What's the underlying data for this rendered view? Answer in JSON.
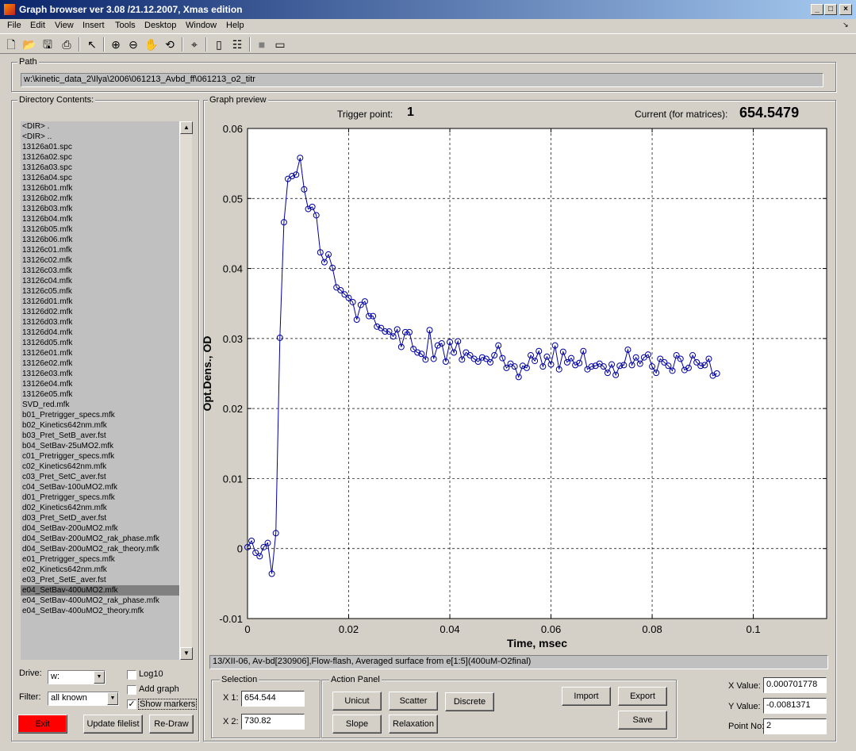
{
  "window": {
    "title": "Graph browser ver 3.08 /21.12.2007, Xmas edition"
  },
  "menu": [
    "File",
    "Edit",
    "View",
    "Insert",
    "Tools",
    "Desktop",
    "Window",
    "Help"
  ],
  "path": {
    "label": "Path",
    "value": "w:\\kinetic_data_2\\Ilya\\2006\\061213_Avbd_ff\\061213_o2_titr"
  },
  "directory": {
    "label": "Directory Contents:",
    "items": [
      "<DIR>      .",
      "<DIR>      ..",
      "13126a01.spc",
      "13126a02.spc",
      "13126a03.spc",
      "13126a04.spc",
      "13126b01.mfk",
      "13126b02.mfk",
      "13126b03.mfk",
      "13126b04.mfk",
      "13126b05.mfk",
      "13126b06.mfk",
      "13126c01.mfk",
      "13126c02.mfk",
      "13126c03.mfk",
      "13126c04.mfk",
      "13126c05.mfk",
      "13126d01.mfk",
      "13126d02.mfk",
      "13126d03.mfk",
      "13126d04.mfk",
      "13126d05.mfk",
      "13126e01.mfk",
      "13126e02.mfk",
      "13126e03.mfk",
      "13126e04.mfk",
      "13126e05.mfk",
      "SVD_red.mfk",
      "b01_Pretrigger_specs.mfk",
      "b02_Kinetics642nm.mfk",
      "b03_Pret_SetB_aver.fst",
      "b04_SetBav-25uMO2.mfk",
      "c01_Pretrigger_specs.mfk",
      "c02_Kinetics642nm.mfk",
      "c03_Pret_SetC_aver.fst",
      "c04_SetBav-100uMO2.mfk",
      "d01_Pretrigger_specs.mfk",
      "d02_Kinetics642nm.mfk",
      "d03_Pret_SetD_aver.fst",
      "d04_SetBav-200uMO2.mfk",
      "d04_SetBav-200uMO2_rak_phase.mfk",
      "d04_SetBav-200uMO2_rak_theory.mfk",
      "e01_Pretrigger_specs.mfk",
      "e02_Kinetics642nm.mfk",
      "e03_Pret_SetE_aver.fst",
      "e04_SetBav-400uMO2.mfk",
      "e04_SetBav-400uMO2_rak_phase.mfk",
      "e04_SetBav-400uMO2_theory.mfk"
    ],
    "selected_index": 45
  },
  "controls": {
    "drive_label": "Drive:",
    "drive_value": "w:",
    "filter_label": "Filter:",
    "filter_value": "all known",
    "log10_label": "Log10",
    "log10_checked": false,
    "addgraph_label": "Add graph",
    "addgraph_checked": false,
    "showmarkers_label": "Show markers",
    "showmarkers_checked": true,
    "exit_label": "Exit",
    "update_label": "Update filelist",
    "redraw_label": "Re-Draw"
  },
  "preview": {
    "label": "Graph preview",
    "trigger_label": "Trigger point:",
    "trigger_value": "1",
    "current_label": "Current (for matrices):",
    "current_value": "654.5479",
    "caption": "13/XII-06, Av-bd[230906],Flow-flash, Averaged surface from e[1:5](400uM-O2final)"
  },
  "selection": {
    "label": "Selection",
    "x1_label": "X 1:",
    "x1_value": "654.544",
    "x2_label": "X 2:",
    "x2_value": "730.82"
  },
  "action_panel": {
    "label": "Action Panel",
    "unicut": "Unicut",
    "scatter": "Scatter",
    "discrete": "Discrete",
    "slope": "Slope",
    "relaxation": "Relaxation",
    "import": "Import",
    "export": "Export",
    "save": "Save"
  },
  "readout": {
    "xvalue_label": "X Value:",
    "xvalue": "0.000701778",
    "yvalue_label": "Y Value:",
    "yvalue": "-0.0081371",
    "pointno_label": "Point No:",
    "pointno": "2"
  },
  "colors": {
    "line": "#0000a0",
    "exit": "#ff0000",
    "titlebar": "#0a246a"
  },
  "chart_data": {
    "type": "line",
    "xlabel": "Time, msec",
    "ylabel": "Opt.Dens., OD",
    "xlim": [
      0,
      0.1145
    ],
    "ylim": [
      -0.01,
      0.06
    ],
    "xticks": [
      0,
      0.02,
      0.04,
      0.06,
      0.08,
      0.1
    ],
    "xtick_labels": [
      "0",
      "0.02",
      "0.04",
      "0.06",
      "0.08",
      "0.1"
    ],
    "yticks": [
      -0.01,
      0,
      0.01,
      0.02,
      0.03,
      0.04,
      0.05,
      0.06
    ],
    "ytick_labels": [
      "-0.01",
      "0",
      "0.01",
      "0.02",
      "0.03",
      "0.04",
      "0.05",
      "0.06"
    ],
    "grid": true,
    "markers": "circle",
    "x_start": 0,
    "x_step": 0.0008,
    "y": [
      0.0002,
      0.0011,
      -0.0006,
      -0.0011,
      0.0002,
      0.0008,
      -0.0036,
      0.0022,
      0.0301,
      0.0466,
      0.0528,
      0.0532,
      0.0534,
      0.0558,
      0.0513,
      0.0485,
      0.0488,
      0.0476,
      0.0423,
      0.0409,
      0.042,
      0.0401,
      0.0373,
      0.0369,
      0.0363,
      0.0358,
      0.0352,
      0.0327,
      0.0348,
      0.0353,
      0.0332,
      0.0332,
      0.0317,
      0.0315,
      0.031,
      0.031,
      0.0303,
      0.0313,
      0.0288,
      0.0309,
      0.0309,
      0.0285,
      0.028,
      0.0278,
      0.027,
      0.0312,
      0.0271,
      0.029,
      0.0293,
      0.0267,
      0.0295,
      0.028,
      0.0296,
      0.027,
      0.028,
      0.0276,
      0.0271,
      0.0267,
      0.0273,
      0.0271,
      0.0266,
      0.0276,
      0.029,
      0.0272,
      0.0258,
      0.0264,
      0.026,
      0.0245,
      0.0261,
      0.0258,
      0.0276,
      0.0268,
      0.0282,
      0.026,
      0.0274,
      0.0263,
      0.029,
      0.0256,
      0.0281,
      0.0266,
      0.0272,
      0.0262,
      0.0265,
      0.0282,
      0.0256,
      0.026,
      0.0261,
      0.0264,
      0.026,
      0.0251,
      0.0263,
      0.0248,
      0.0261,
      0.0262,
      0.0284,
      0.0262,
      0.0273,
      0.0264,
      0.0273,
      0.0277,
      0.026,
      0.0251,
      0.0271,
      0.0266,
      0.0261,
      0.0254,
      0.0276,
      0.0271,
      0.0255,
      0.0258,
      0.0276,
      0.0266,
      0.0261,
      0.0262,
      0.0271,
      0.0247,
      0.025
    ]
  }
}
